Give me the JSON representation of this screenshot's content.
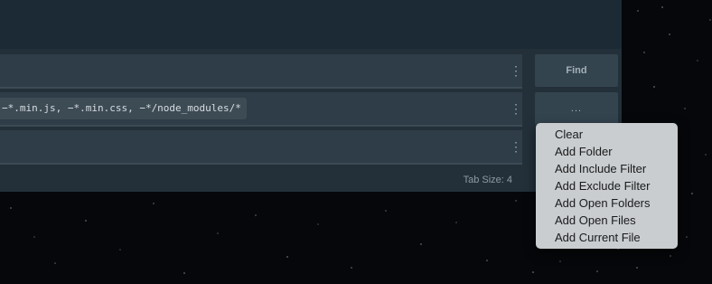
{
  "search": {
    "rows": [
      {
        "value": ""
      },
      {
        "value": "−*.min.js, −*.min.css, −*/node_modules/*"
      },
      {
        "value": ""
      }
    ],
    "kebab_icon": "vertical-ellipsis-icon",
    "find_label": "Find",
    "more_label": "...",
    "tab_size": "Tab Size: 4"
  },
  "menu": {
    "items": [
      "Clear",
      "Add Folder",
      "Add Include Filter",
      "Add Exclude Filter",
      "Add Open Folders",
      "Add Open Files",
      "Add Current File"
    ]
  },
  "colors": {
    "panel": "#233039",
    "header": "#1b2a34",
    "row": "#2e3d47",
    "menu": "#c9cdd0"
  }
}
